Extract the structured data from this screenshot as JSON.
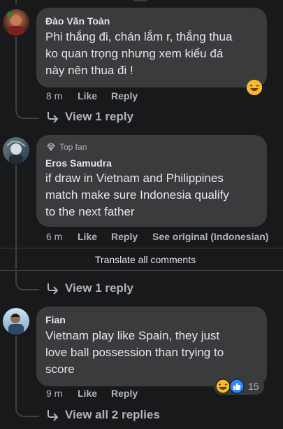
{
  "comments": [
    {
      "author": "Đào Văn Toàn",
      "text_lines": [
        "Phi thắng đi, chán lắm r, thắng thua",
        "ko quan trọng nhưng xem kiểu đá",
        "này nên thua đi !"
      ],
      "time": "8 m",
      "like_label": "Like",
      "reply_label": "Reply",
      "reaction": "laughing-emoji",
      "view_replies": "View 1 reply"
    },
    {
      "badge": "Top fan",
      "author": "Eros Samudra",
      "text_lines": [
        "if draw in Vietnam and Philippines",
        "match make sure Indonesia qualify",
        "to the next father"
      ],
      "time": "6 m",
      "like_label": "Like",
      "reply_label": "Reply",
      "see_original": "See original (Indonesian)",
      "translate_all": "Translate all comments",
      "view_replies": "View 1 reply"
    },
    {
      "author": "Fian",
      "text_lines": [
        "Vietnam play like Spain, they just",
        "love ball possession than trying to",
        "score"
      ],
      "time": "9 m",
      "like_label": "Like",
      "reply_label": "Reply",
      "reaction_count": "15",
      "view_replies": "View all 2 replies"
    }
  ],
  "colors": {
    "background": "#18191a",
    "bubble": "#3a3b3c",
    "text": "#e4e6eb",
    "muted": "#b0b3b8",
    "like_blue": "#2d88ff"
  }
}
